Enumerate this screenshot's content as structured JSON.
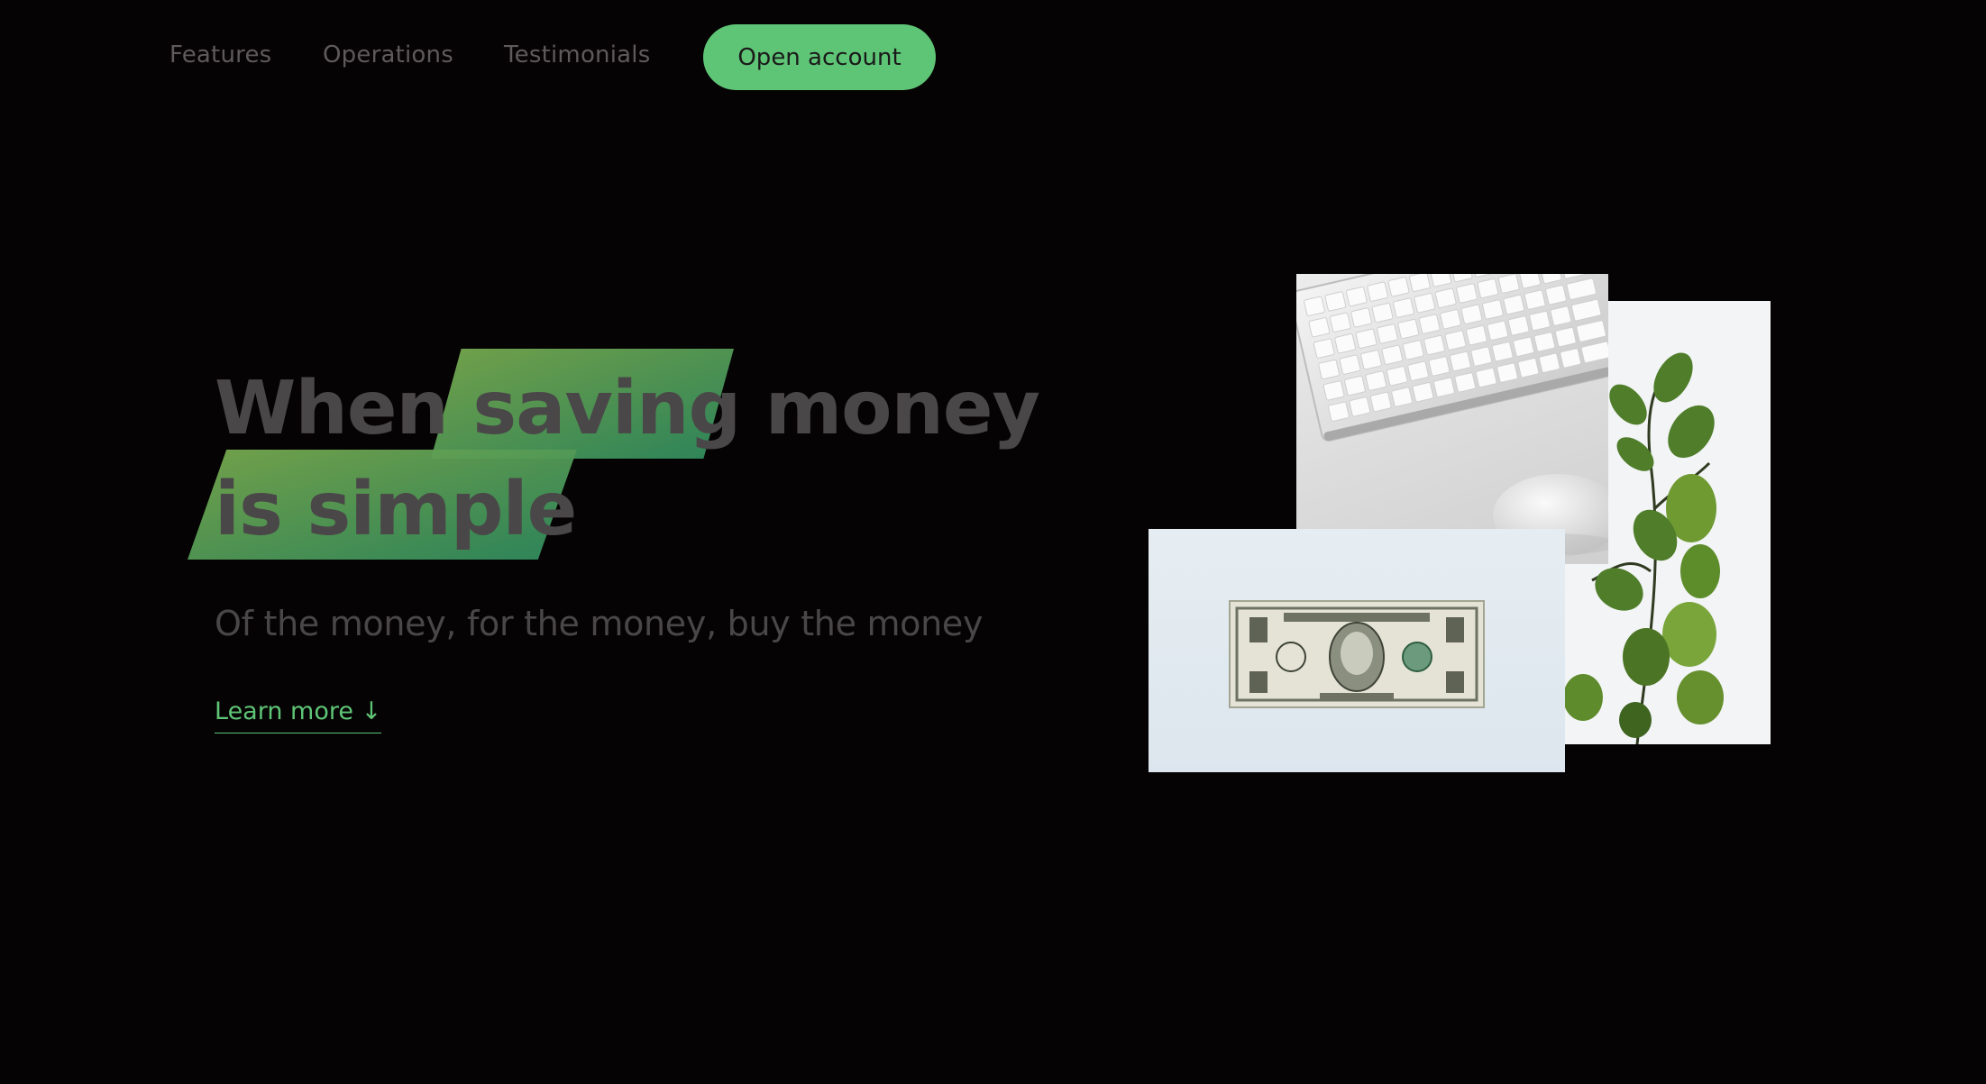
{
  "nav": {
    "links": [
      {
        "label": "Features"
      },
      {
        "label": "Operations"
      },
      {
        "label": "Testimonials"
      }
    ],
    "cta_label": "Open account"
  },
  "hero": {
    "title_part1": "When ",
    "title_highlight1": "saving",
    "title_part2": " money",
    "title_highlight2": "is simple",
    "subtitle": "Of the money, for the money, buy the money",
    "learn_more": "Learn more ↓"
  },
  "images": [
    {
      "subject": "keyboard-and-mouse"
    },
    {
      "subject": "eucalyptus-plant"
    },
    {
      "subject": "dollar-bill"
    }
  ],
  "colors": {
    "background": "#060304",
    "accent": "#5ec576",
    "text": "#4a4748"
  }
}
